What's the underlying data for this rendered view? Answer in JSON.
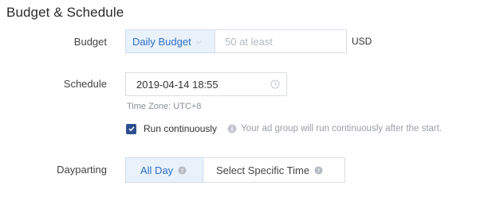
{
  "section": {
    "title": "Budget & Schedule"
  },
  "budget": {
    "label": "Budget",
    "type_selected": "Daily Budget",
    "amount_value": "",
    "amount_placeholder": "50 at least",
    "currency": "USD"
  },
  "schedule": {
    "label": "Schedule",
    "start_datetime": "2019-04-14 18:55",
    "timezone": "Time Zone: UTC+8",
    "run_continuously_label": "Run continuously",
    "run_continuously_checked": true,
    "run_continuously_hint": "Your ad group will run continuously after the start."
  },
  "dayparting": {
    "label": "Dayparting",
    "options": [
      {
        "label": "All Day",
        "selected": true
      },
      {
        "label": "Select Specific Time",
        "selected": false
      }
    ]
  },
  "colors": {
    "accent": "#2d6fc6",
    "checkbox": "#2c4f8f",
    "muted": "#9a9ea5"
  },
  "icons": {
    "budget_type": "chevron-down-icon",
    "date": "clock-icon",
    "hint": "info-icon",
    "option_help": "question-icon"
  }
}
